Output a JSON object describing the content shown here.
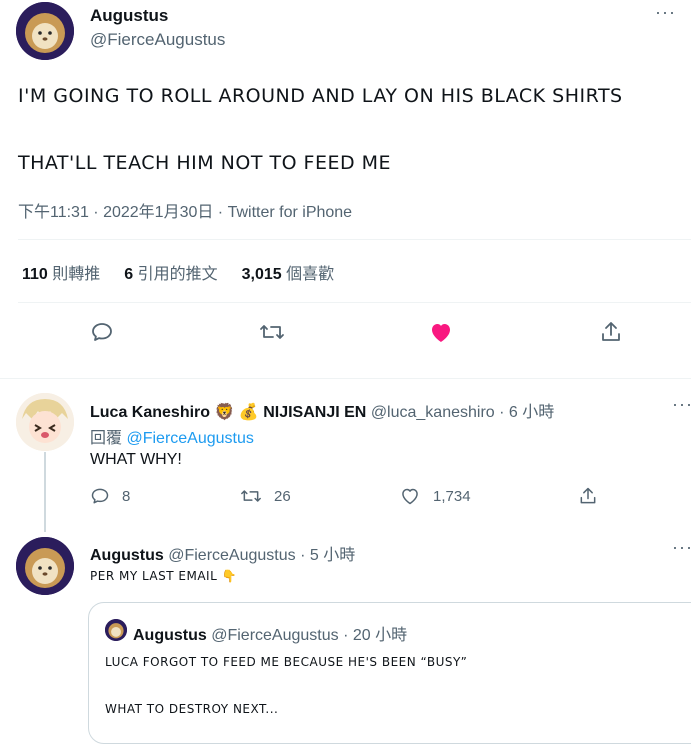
{
  "main_tweet": {
    "author_name": "Augustus",
    "author_handle": "@FierceAugustus",
    "line1": "I'M GOING TO ROLL AROUND AND LAY ON HIS BLACK SHIRTS",
    "line2": "THAT'LL TEACH HIM NOT TO FEED ME",
    "timestamp": "下午11:31 · 2022年1月30日 · Twitter for iPhone",
    "stats": {
      "retweets_count": "110",
      "retweets_label": "則轉推",
      "quotes_count": "6",
      "quotes_label": "引用的推文",
      "likes_count": "3,015",
      "likes_label": "個喜歡"
    },
    "liked": true,
    "like_color": "#f91880"
  },
  "reply1": {
    "author_name": "Luca Kaneshiro 🦁 💰 NIJISANJI EN",
    "author_handle": "@luca_kaneshiro",
    "time": "· 6 小時",
    "reply_prefix": "回覆",
    "reply_to": "@FierceAugustus",
    "text": "WHAT WHY!",
    "reply_count": "8",
    "retweet_count": "26",
    "like_count": "1,734"
  },
  "reply2": {
    "author_name": "Augustus",
    "author_handle": "@FierceAugustus",
    "time": "· 5 小時",
    "text": "PER MY LAST EMAIL 👇",
    "quoted": {
      "author_name": "Augustus",
      "author_handle": "@FierceAugustus",
      "time": "· 20 小時",
      "line1": "LUCA FORGOT TO FEED ME BECAUSE HE'S BEEN “BUSY”",
      "line2": "WHAT TO DESTROY NEXT..."
    }
  },
  "more_label": "···",
  "accent_color": "#1d9bf0"
}
